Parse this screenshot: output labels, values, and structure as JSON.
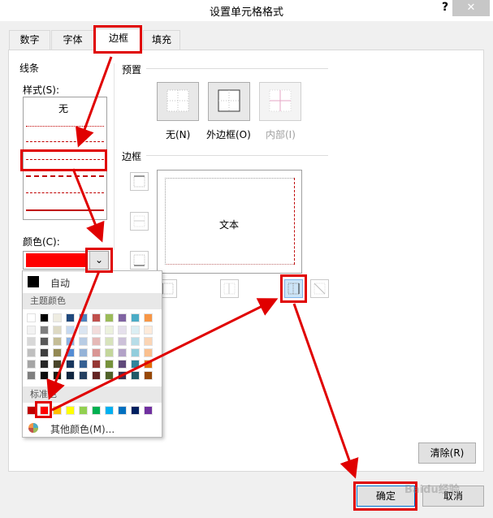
{
  "window": {
    "title": "设置单元格格式",
    "help": "?",
    "close": "✕"
  },
  "tabs": [
    {
      "label": "数字"
    },
    {
      "label": "字体"
    },
    {
      "label": "边框",
      "active": true
    },
    {
      "label": "填充"
    }
  ],
  "line_group": {
    "title": "线条",
    "style_label": "样式(S):",
    "none_label": "无",
    "color_label": "颜色(C):",
    "selected_color": "#ff0000"
  },
  "presets": {
    "title": "预置",
    "items": [
      {
        "label": "无(N)"
      },
      {
        "label": "外边框(O)"
      },
      {
        "label": "内部(I)"
      }
    ]
  },
  "border_group": {
    "title": "边框",
    "preview_text": "文本"
  },
  "color_popup": {
    "auto_label": "自动",
    "theme_header": "主题颜色",
    "standard_header": "标准色",
    "more_label": "其他颜色(M)...",
    "theme_colors": [
      [
        "#ffffff",
        "#000000",
        "#eeece1",
        "#1f497d",
        "#4f81bd",
        "#c0504d",
        "#9bbb59",
        "#8064a2",
        "#4bacc6",
        "#f79646"
      ],
      [
        "#f2f2f2",
        "#7f7f7f",
        "#ddd9c3",
        "#c6d9f0",
        "#dbe5f1",
        "#f2dcdb",
        "#ebf1dd",
        "#e5e0ec",
        "#dbeef3",
        "#fdeada"
      ],
      [
        "#d8d8d8",
        "#595959",
        "#c4bd97",
        "#8db3e2",
        "#b8cce4",
        "#e5b9b7",
        "#d7e3bc",
        "#ccc1d9",
        "#b7dde8",
        "#fbd5b5"
      ],
      [
        "#bfbfbf",
        "#3f3f3f",
        "#938953",
        "#548dd4",
        "#95b3d7",
        "#d99694",
        "#c3d69b",
        "#b2a2c7",
        "#92cddc",
        "#fac08f"
      ],
      [
        "#a5a5a5",
        "#262626",
        "#494429",
        "#17365d",
        "#366092",
        "#953734",
        "#76923c",
        "#5f497a",
        "#31859b",
        "#e36c09"
      ],
      [
        "#7f7f7f",
        "#0c0c0c",
        "#1d1b10",
        "#0f243e",
        "#244061",
        "#632423",
        "#4f6128",
        "#3f3151",
        "#205867",
        "#974806"
      ]
    ],
    "standard_colors": [
      "#c00000",
      "#ff0000",
      "#ffc000",
      "#ffff00",
      "#92d050",
      "#00b050",
      "#00b0f0",
      "#0070c0",
      "#002060",
      "#7030a0"
    ]
  },
  "buttons": {
    "clear": "清除(R)",
    "ok": "确定",
    "cancel": "取消"
  },
  "watermark": "Baidu经验"
}
